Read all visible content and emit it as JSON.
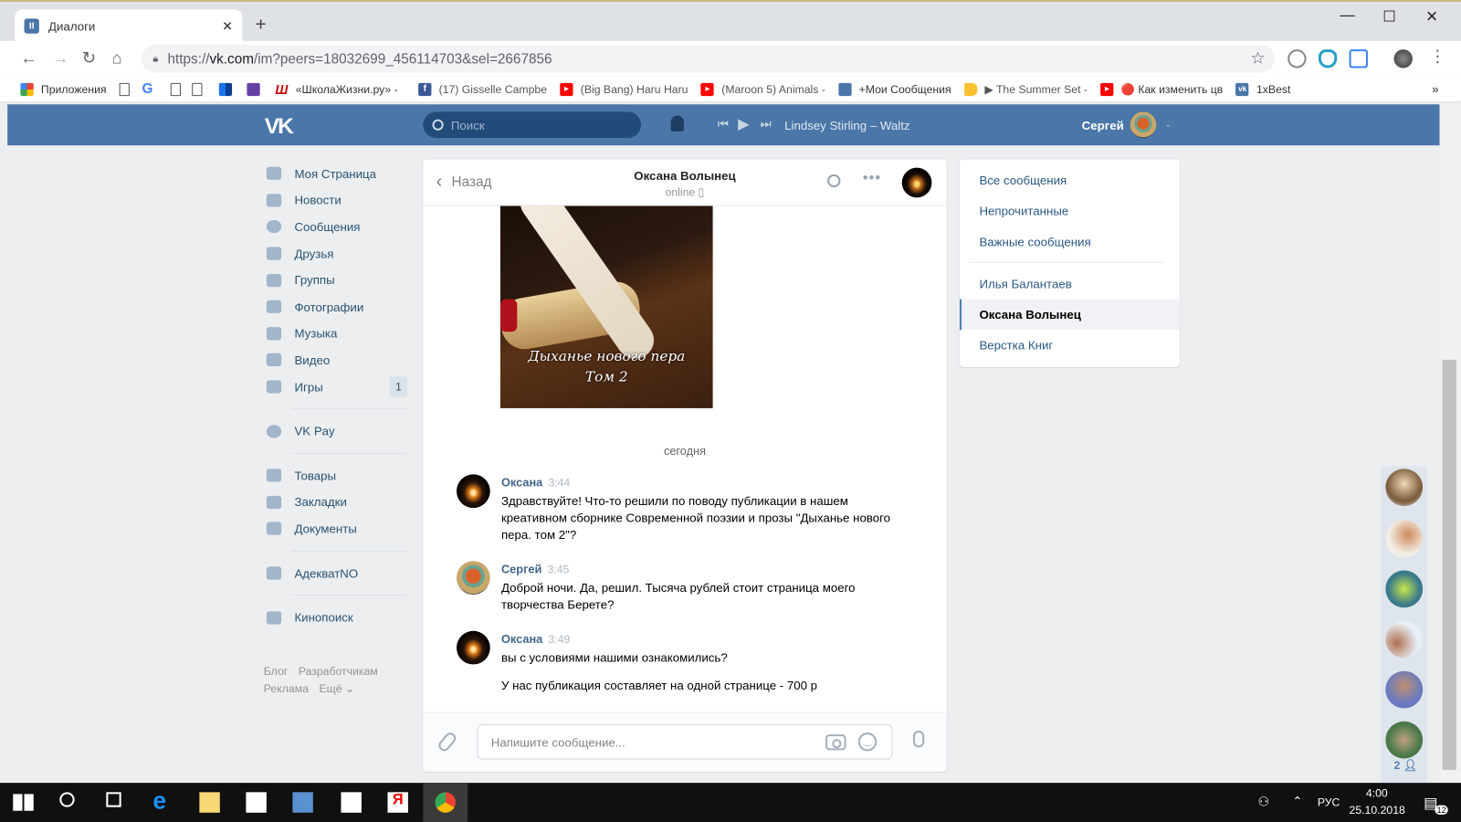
{
  "browser": {
    "tab_title": "Диалоги",
    "tab_favicon": "vk-messages-icon",
    "url_prefix": "https://",
    "url_host": "vk.com",
    "url_path": "/im?peers=18032699_456114703&sel=2667856",
    "bookmarks": [
      {
        "label": "Приложения",
        "icon": "apps-grid-icon"
      },
      {
        "label": "",
        "icon": "file-icon"
      },
      {
        "label": "",
        "icon": "google-icon"
      },
      {
        "label": "",
        "icon": "file-icon"
      },
      {
        "label": "",
        "icon": "file-icon"
      },
      {
        "label": "",
        "icon": "bars-icon"
      },
      {
        "label": "",
        "icon": "twitch-icon"
      },
      {
        "label": "«ШколаЖизни.ру» -",
        "icon": "shkola-icon"
      },
      {
        "label": "(17) Gisselle Campbe",
        "icon": "facebook-icon"
      },
      {
        "label": "(Big Bang) Haru Haru",
        "icon": "youtube-icon"
      },
      {
        "label": "(Maroon 5) Animals -",
        "icon": "youtube-icon"
      },
      {
        "label": "+Мои Сообщения",
        "icon": "chat-icon"
      },
      {
        "label": "▶ The Summer Set -",
        "icon": "tag-icon"
      },
      {
        "label": "🔴 Как изменить цв",
        "icon": "youtube-icon"
      },
      {
        "label": "1xBest",
        "icon": "vk-icon"
      }
    ],
    "bookmarks_more": "»"
  },
  "vk_header": {
    "search_placeholder": "Поиск",
    "track": "Lindsey Stirling – Waltz",
    "user_name": "Сергей"
  },
  "left_nav": {
    "items": [
      {
        "label": "Моя Страница",
        "icon": "home-icon"
      },
      {
        "label": "Новости",
        "icon": "news-icon"
      },
      {
        "label": "Сообщения",
        "icon": "messages-icon"
      },
      {
        "label": "Друзья",
        "icon": "friends-icon"
      },
      {
        "label": "Группы",
        "icon": "groups-icon"
      },
      {
        "label": "Фотографии",
        "icon": "camera-icon"
      },
      {
        "label": "Музыка",
        "icon": "music-icon"
      },
      {
        "label": "Видео",
        "icon": "video-icon"
      },
      {
        "label": "Игры",
        "icon": "gamepad-icon",
        "badge": "1"
      }
    ],
    "items2": [
      {
        "label": "VK Pay",
        "icon": "vkpay-icon"
      }
    ],
    "items3": [
      {
        "label": "Товары",
        "icon": "bag-icon"
      },
      {
        "label": "Закладки",
        "icon": "star-icon"
      },
      {
        "label": "Документы",
        "icon": "document-icon"
      }
    ],
    "items4": [
      {
        "label": "АдекватNO",
        "icon": "group-icon"
      }
    ],
    "items5": [
      {
        "label": "Кинопоиск",
        "icon": "apps-icon"
      }
    ],
    "footer": {
      "blog": "Блог",
      "dev": "Разработчикам",
      "ads": "Реклама",
      "more": "Ещё ⌄"
    }
  },
  "chat": {
    "back_label": "Назад",
    "peer_name": "Оксана Волынец",
    "peer_status": "online",
    "photo_caption_line1": "Дыханье нового пера",
    "photo_caption_line2": "Том 2",
    "date_separator": "сегодня",
    "messages": [
      {
        "author": "Оксана",
        "time": "3:44",
        "texts": [
          "Здравствуйте! Что-то решили по поводу публикации в нашем креативном сборнике Современной поэзии и прозы \"Дыханье нового пера. том 2\"?"
        ]
      },
      {
        "author": "Сергей",
        "time": "3:45",
        "texts": [
          "Доброй ночи. Да, решил. Тысяча рублей стоит страница моего творчества Берете?"
        ]
      },
      {
        "author": "Оксана",
        "time": "3:49",
        "texts": [
          "вы с условиями нашими ознакомились?",
          "У нас публикация составляет на одной странице - 700 р"
        ]
      }
    ],
    "composer_placeholder": "Напишите сообщение..."
  },
  "right_panel": {
    "filters": [
      "Все сообщения",
      "Непрочитанные",
      "Важные сообщения"
    ],
    "dialogs": [
      {
        "label": "Илья Балантаев",
        "active": false
      },
      {
        "label": "Оксана Волынец",
        "active": true
      },
      {
        "label": "Верстка Книг",
        "active": false
      }
    ]
  },
  "friends_strip": {
    "count": "2"
  },
  "taskbar": {
    "language": "РУС",
    "time": "4:00",
    "date": "25.10.2018",
    "notifications": "12"
  },
  "colors": {
    "vk_blue": "#4a76a8",
    "link": "#2a5885",
    "author": "#42648b"
  }
}
